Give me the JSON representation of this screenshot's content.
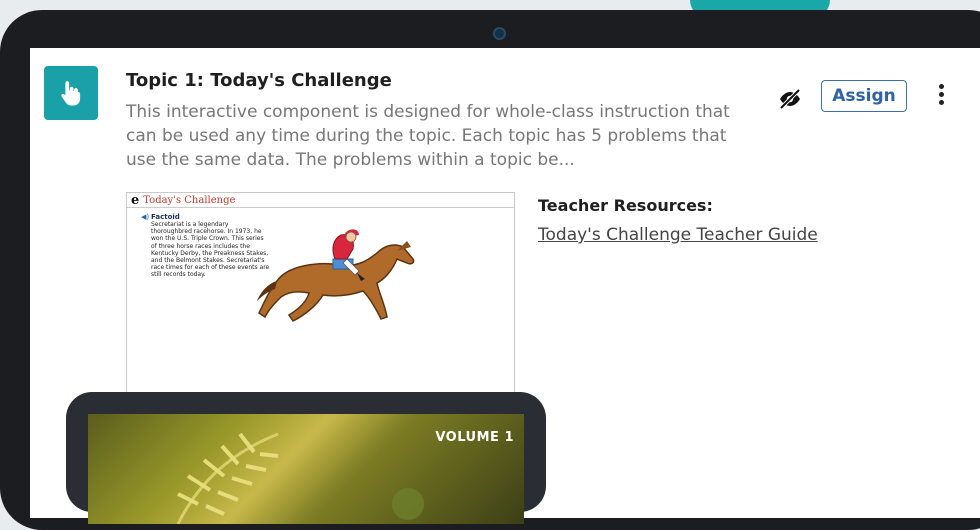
{
  "colors": {
    "accent": "#1aa0a8",
    "assign_border": "#3a6fb7",
    "heading": "#1f1f1f",
    "description": "#777777"
  },
  "card": {
    "icon": "pointer-hand-icon",
    "title": "Topic 1: Today's Challenge",
    "description": "This interactive component is designed for whole-class instruction that can be used any time during the topic. Each topic has 5 problems that use the same data. The problems within a topic be...",
    "actions": {
      "visibility_icon": "eye-off-icon",
      "assign_label": "Assign",
      "more_icon": "kebab-menu-icon"
    }
  },
  "thumbnail": {
    "header_logo": "e",
    "header_title": "Today's Challenge",
    "factoid_title": "Factoid",
    "factoid_text": "Secretariat is a legendary thoroughbred racehorse. In 1973, he won the U.S. Triple Crown. This series of three horse races includes the Kentucky Derby, the Preakness Stakes, and the Belmont Stakes. Secretariat's race times for each of these events are still records today."
  },
  "resources": {
    "title": "Teacher Resources:",
    "link_label": "Today's Challenge Teacher Guide"
  },
  "overlay_tablet": {
    "volume_label": "VOLUME 1"
  }
}
